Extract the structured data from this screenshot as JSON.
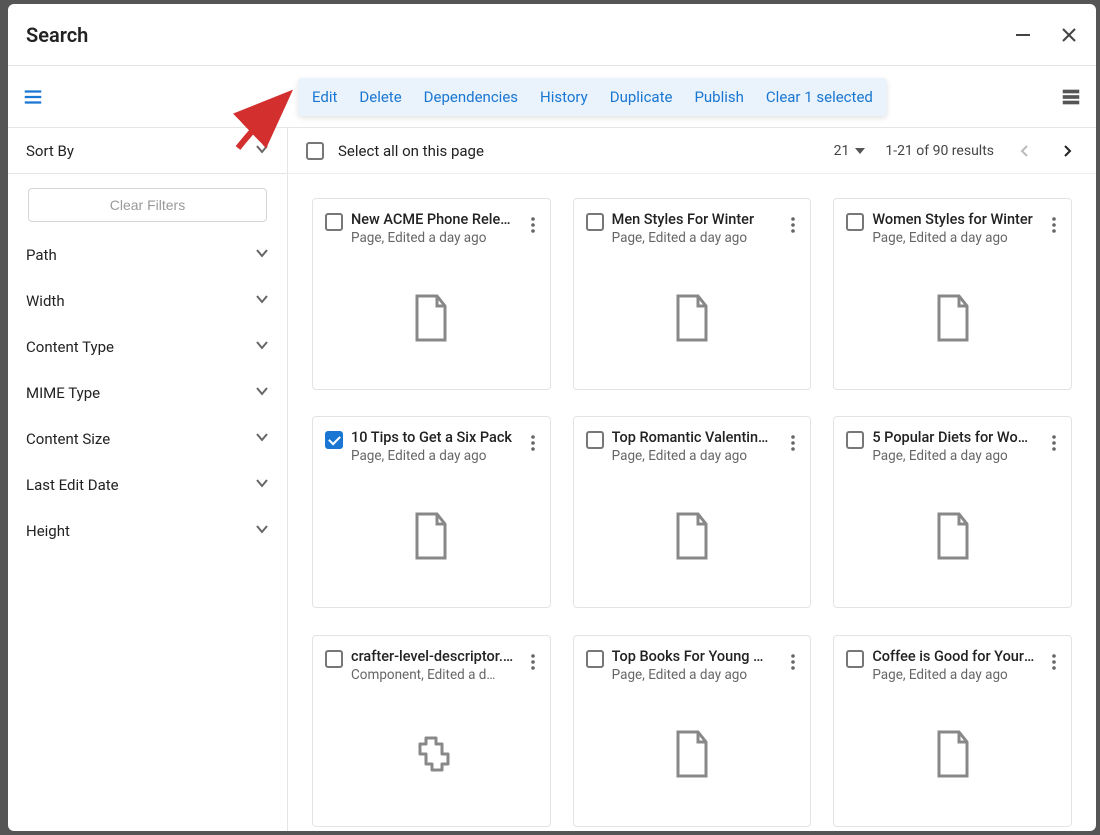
{
  "header": {
    "title": "Search"
  },
  "actionToolbar": {
    "edit": "Edit",
    "delete": "Delete",
    "dependencies": "Dependencies",
    "history": "History",
    "duplicate": "Duplicate",
    "publish": "Publish",
    "clearSelected": "Clear 1 selected"
  },
  "sidebar": {
    "sortBy": "Sort By",
    "clearFilters": "Clear Filters",
    "filters": [
      {
        "label": "Path"
      },
      {
        "label": "Width"
      },
      {
        "label": "Content Type"
      },
      {
        "label": "MIME Type"
      },
      {
        "label": "Content Size"
      },
      {
        "label": "Last Edit Date"
      },
      {
        "label": "Height"
      }
    ]
  },
  "contentHeader": {
    "selectAll": "Select all on this page",
    "pageSize": "21",
    "resultsText": "1-21 of 90 results"
  },
  "cards": [
    {
      "title": "New ACME Phone Relea…",
      "sub": "Page, Edited a day ago",
      "checked": false,
      "icon": "page"
    },
    {
      "title": "Men Styles For Winter",
      "sub": "Page, Edited a day ago",
      "checked": false,
      "icon": "page"
    },
    {
      "title": "Women Styles for Winter",
      "sub": "Page, Edited a day ago",
      "checked": false,
      "icon": "page"
    },
    {
      "title": "10 Tips to Get a Six Pack",
      "sub": "Page, Edited a day ago",
      "checked": true,
      "icon": "page"
    },
    {
      "title": "Top Romantic Valentine…",
      "sub": "Page, Edited a day ago",
      "checked": false,
      "icon": "page"
    },
    {
      "title": "5 Popular Diets for Wo…",
      "sub": "Page, Edited a day ago",
      "checked": false,
      "icon": "page"
    },
    {
      "title": "crafter-level-descriptor.…",
      "sub": "Component, Edited a d…",
      "checked": false,
      "icon": "component"
    },
    {
      "title": "Top Books For Young W…",
      "sub": "Page, Edited a day ago",
      "checked": false,
      "icon": "page"
    },
    {
      "title": "Coffee is Good for Your …",
      "sub": "Page, Edited a day ago",
      "checked": false,
      "icon": "page"
    }
  ]
}
